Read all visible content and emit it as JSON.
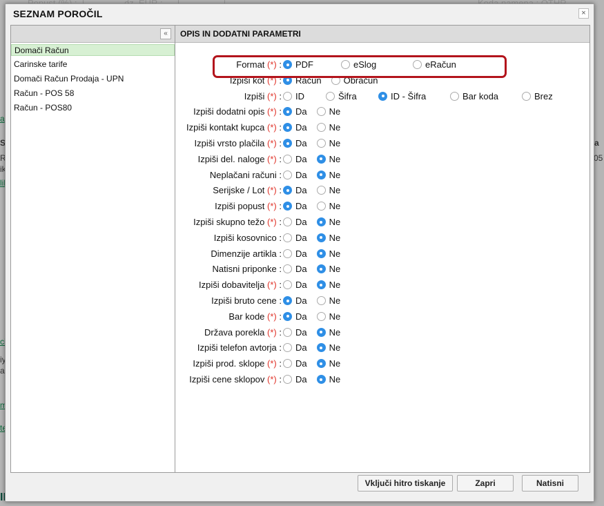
{
  "background": {
    "top_left_text": "Popust (%) :",
    "top_mid_text": "oz. EUR :",
    "top_right_text": "Koda namena : OTHR",
    "bottom_heading": "II DOKUMENTI:",
    "edge_texts": [
      "a",
      "Si",
      "R'",
      "ik",
      "lik",
      "ci",
      "iy",
      "an",
      "m",
      "te",
      "a",
      "05"
    ]
  },
  "modal": {
    "title": "SEZNAM POROČIL",
    "close_glyph": "×",
    "collapse_glyph": "«",
    "right_header": "OPIS IN DODATNI PARAMETRI",
    "reports": [
      {
        "label": "Domači Račun",
        "selected": true
      },
      {
        "label": "Carinske tarife",
        "selected": false
      },
      {
        "label": "Domači Račun Prodaja - UPN",
        "selected": false
      },
      {
        "label": "Račun - POS 58",
        "selected": false
      },
      {
        "label": "Račun - POS80",
        "selected": false
      }
    ],
    "required_mark": "(*)",
    "params": [
      {
        "label": "Format",
        "required": true,
        "options": [
          "PDF",
          "eSlog",
          "eRačun"
        ],
        "selected": 0
      },
      {
        "label": "Izpiši kot",
        "required": true,
        "options": [
          "Račun",
          "Obračun"
        ],
        "selected": 0
      },
      {
        "label": "Izpiši",
        "required": true,
        "options": [
          "ID",
          "Šifra",
          "ID - Šifra",
          "Bar koda",
          "Brez"
        ],
        "selected": 2
      },
      {
        "label": "Izpiši dodatni opis",
        "required": true,
        "options": [
          "Da",
          "Ne"
        ],
        "selected": 0
      },
      {
        "label": "Izpiši kontakt kupca",
        "required": true,
        "options": [
          "Da",
          "Ne"
        ],
        "selected": 0
      },
      {
        "label": "Izpiši vrsto plačila",
        "required": true,
        "options": [
          "Da",
          "Ne"
        ],
        "selected": 0
      },
      {
        "label": "Izpiši del. naloge",
        "required": true,
        "options": [
          "Da",
          "Ne"
        ],
        "selected": 1
      },
      {
        "label": "Neplačani računi",
        "required": false,
        "options": [
          "Da",
          "Ne"
        ],
        "selected": 1
      },
      {
        "label": "Serijske / Lot",
        "required": true,
        "options": [
          "Da",
          "Ne"
        ],
        "selected": 0
      },
      {
        "label": "Izpiši popust",
        "required": true,
        "options": [
          "Da",
          "Ne"
        ],
        "selected": 0
      },
      {
        "label": "Izpiši skupno težo",
        "required": true,
        "options": [
          "Da",
          "Ne"
        ],
        "selected": 1
      },
      {
        "label": "Izpiši kosovnico",
        "required": false,
        "options": [
          "Da",
          "Ne"
        ],
        "selected": 1
      },
      {
        "label": "Dimenzije artikla",
        "required": false,
        "options": [
          "Da",
          "Ne"
        ],
        "selected": 1
      },
      {
        "label": "Natisni priponke",
        "required": false,
        "options": [
          "Da",
          "Ne"
        ],
        "selected": 1
      },
      {
        "label": "Izpiši dobavitelja",
        "required": true,
        "options": [
          "Da",
          "Ne"
        ],
        "selected": 1
      },
      {
        "label": "Izpiši bruto cene",
        "required": false,
        "options": [
          "Da",
          "Ne"
        ],
        "selected": 0
      },
      {
        "label": "Bar kode",
        "required": true,
        "options": [
          "Da",
          "Ne"
        ],
        "selected": 0
      },
      {
        "label": "Država porekla",
        "required": true,
        "options": [
          "Da",
          "Ne"
        ],
        "selected": 1
      },
      {
        "label": "Izpiši telefon avtorja",
        "required": false,
        "options": [
          "Da",
          "Ne"
        ],
        "selected": 1
      },
      {
        "label": "Izpiši prod. sklope",
        "required": true,
        "options": [
          "Da",
          "Ne"
        ],
        "selected": 1
      },
      {
        "label": "Izpiši cene sklopov",
        "required": true,
        "options": [
          "Da",
          "Ne"
        ],
        "selected": 1
      }
    ],
    "buttons": {
      "quick_print": "Vključi hitro tiskanje",
      "close": "Zapri",
      "print": "Natisni"
    }
  },
  "colors": {
    "accent_radio": "#2f8fe6",
    "required_red": "#e0342a",
    "highlight_red": "#b3141c",
    "selected_item_bg": "#d7f0d3"
  }
}
